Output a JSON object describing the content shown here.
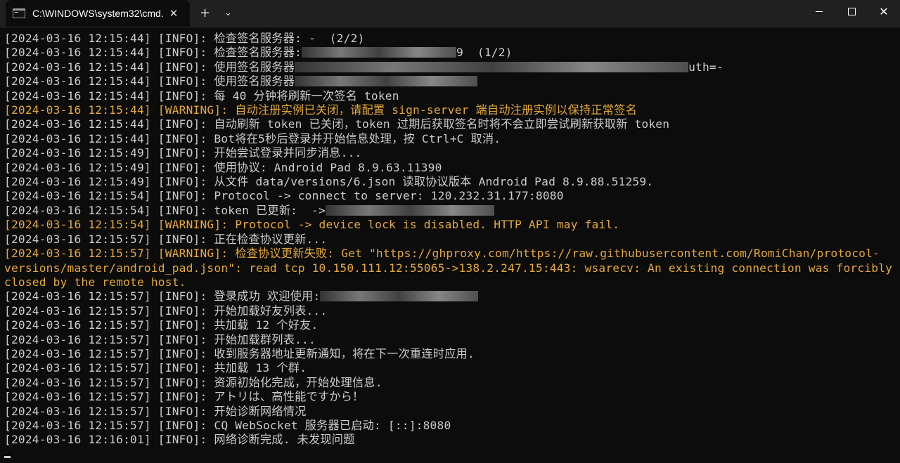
{
  "window": {
    "tab_title": "C:\\WINDOWS\\system32\\cmd.",
    "tab_close": "✕",
    "new_tab": "+",
    "dropdown": "⌄",
    "close_glyph": "✕"
  },
  "console": {
    "lines": [
      {
        "t": "[2024-03-16 12:15:44] [INFO]: 检查签名服务器: -  (2/2)"
      },
      {
        "t": "[2024-03-16 12:15:44] [INFO]: 检查签名服务器:",
        "r": 220,
        "t2": "9  (1/2)"
      },
      {
        "t": "[2024-03-16 12:15:44] [INFO]: 使用签名服务器",
        "r": 560,
        "t2": "uth=-"
      },
      {
        "t": "[2024-03-16 12:15:44] [INFO]: 使用签名服务器",
        "r": 260
      },
      {
        "t": "[2024-03-16 12:15:44] [INFO]: 每 40 分钟将刷新一次签名 token"
      },
      {
        "t": "[2024-03-16 12:15:44] [WARNING]: 自动注册实例已关闭，请配置 sign-server 端自动注册实例以保持正常签名",
        "w": true
      },
      {
        "t": "[2024-03-16 12:15:44] [INFO]: 自动刷新 token 已关闭，token 过期后获取签名时将不会立即尝试刷新获取新 token"
      },
      {
        "t": "[2024-03-16 12:15:44] [INFO]: Bot将在5秒后登录并开始信息处理，按 Ctrl+C 取消."
      },
      {
        "t": "[2024-03-16 12:15:49] [INFO]: 开始尝试登录并同步消息..."
      },
      {
        "t": "[2024-03-16 12:15:49] [INFO]: 使用协议: Android Pad 8.9.63.11390"
      },
      {
        "t": "[2024-03-16 12:15:49] [INFO]: 从文件 data/versions/6.json 读取协议版本 Android Pad 8.9.88.51259."
      },
      {
        "t": "[2024-03-16 12:15:54] [INFO]: Protocol -> connect to server: 120.232.31.177:8080"
      },
      {
        "t": "[2024-03-16 12:15:54] [INFO]: token 已更新:  ->",
        "r": 240
      },
      {
        "t": "[2024-03-16 12:15:54] [WARNING]: Protocol -> device lock is disabled. HTTP API may fail.",
        "w": true
      },
      {
        "t": "[2024-03-16 12:15:57] [INFO]: 正在检查协议更新..."
      },
      {
        "t": "[2024-03-16 12:15:57] [WARNING]: 检查协议更新失败: Get \"https://ghproxy.com/https://raw.githubusercontent.com/RomiChan/protocol-versions/master/android_pad.json\": read tcp 10.150.111.12:55065->138.2.247.15:443: wsarecv: An existing connection was forcibly closed by the remote host.",
        "w": true
      },
      {
        "t": "[2024-03-16 12:15:57] [INFO]: 登录成功 欢迎使用:",
        "r": 225
      },
      {
        "t": "[2024-03-16 12:15:57] [INFO]: 开始加载好友列表..."
      },
      {
        "t": "[2024-03-16 12:15:57] [INFO]: 共加载 12 个好友."
      },
      {
        "t": "[2024-03-16 12:15:57] [INFO]: 开始加载群列表..."
      },
      {
        "t": "[2024-03-16 12:15:57] [INFO]: 收到服务器地址更新通知，将在下一次重连时应用."
      },
      {
        "t": "[2024-03-16 12:15:57] [INFO]: 共加载 13 个群."
      },
      {
        "t": "[2024-03-16 12:15:57] [INFO]: 资源初始化完成，开始处理信息."
      },
      {
        "t": "[2024-03-16 12:15:57] [INFO]: アトリは、高性能ですから！"
      },
      {
        "t": "[2024-03-16 12:15:57] [INFO]: 开始诊断网络情况"
      },
      {
        "t": "[2024-03-16 12:15:57] [INFO]: CQ WebSocket 服务器已启动: [::]:8080"
      },
      {
        "t": "[2024-03-16 12:16:01] [INFO]: 网络诊断完成. 未发现问题"
      }
    ]
  }
}
